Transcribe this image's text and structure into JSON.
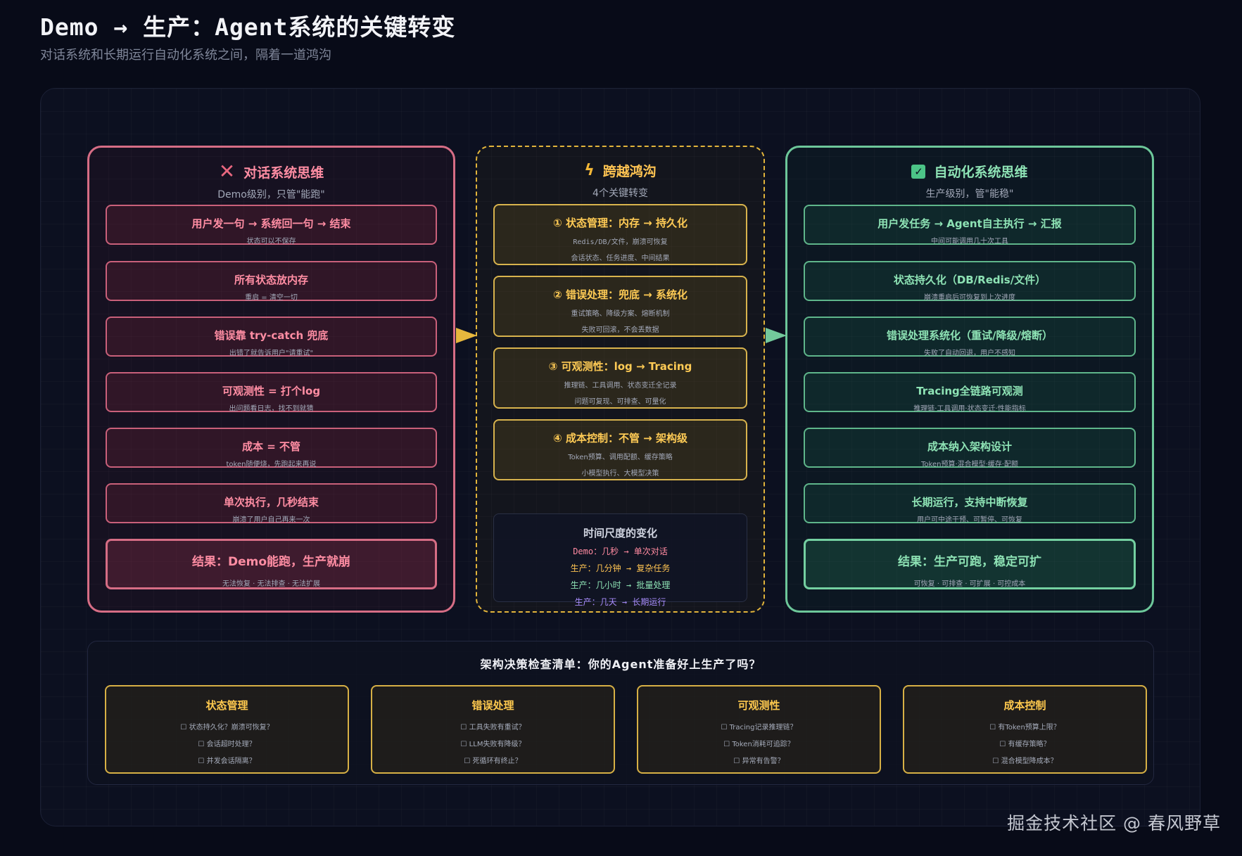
{
  "header": {
    "title": "Demo → 生产：Agent系统的关键转变",
    "subtitle": "对话系统和长期运行自动化系统之间，隔着一道鸿沟"
  },
  "left": {
    "icon": "x-icon",
    "title": "对话系统思维",
    "subtitle": "Demo级别，只管\"能跑\"",
    "cards": [
      {
        "t": "用户发一句 → 系统回一句 → 结束",
        "s": "状态可以不保存"
      },
      {
        "t": "所有状态放内存",
        "s": "重启 = 清空一切"
      },
      {
        "t": "错误靠 try-catch 兜底",
        "s": "出错了就告诉用户\"请重试\""
      },
      {
        "t": "可观测性 = 打个log",
        "s": "出问题看日志，找不到就猜"
      },
      {
        "t": "成本 = 不管",
        "s": "token随便烧，先跑起来再说"
      },
      {
        "t": "单次执行，几秒结束",
        "s": "崩溃了用户自己再来一次"
      }
    ],
    "final": {
      "t": "结果：Demo能跑，生产就崩",
      "s": "无法恢复 · 无法排查 · 无法扩展"
    }
  },
  "middle": {
    "icon": "lightning-icon",
    "title": "跨越鸿沟",
    "subtitle": "4个关键转变",
    "cards": [
      {
        "t": "① 状态管理：内存 → 持久化",
        "s": "Redis/DB/文件，崩溃可恢复",
        "s2": "会话状态、任务进度、中间结果"
      },
      {
        "t": "② 错误处理：兜底 → 系统化",
        "s": "重试策略、降级方案、熔断机制",
        "s2": "失败可回滚，不会丢数据"
      },
      {
        "t": "③ 可观测性：log → Tracing",
        "s": "推理链、工具调用、状态变迁全记录",
        "s2": "问题可复现、可排查、可量化"
      },
      {
        "t": "④ 成本控制：不管 → 架构级",
        "s": "Token预算、调用配额、缓存策略",
        "s2": "小模型执行、大模型决策"
      }
    ],
    "scale": {
      "title": "时间尺度的变化",
      "rows": [
        {
          "text": "Demo：几秒 → 单次对话",
          "color": "#ff8aa0"
        },
        {
          "text": "生产：几分钟 → 复杂任务",
          "color": "#ffc452"
        },
        {
          "text": "生产：几小时 → 批量处理",
          "color": "#8ee3b5"
        },
        {
          "text": "生产：几天 → 长期运行",
          "color": "#a78bfa"
        }
      ]
    }
  },
  "right": {
    "icon": "check-icon",
    "title": "自动化系统思维",
    "subtitle": "生产级别，管\"能稳\"",
    "cards": [
      {
        "t": "用户发任务 → Agent自主执行 → 汇报",
        "s": "中间可能调用几十次工具"
      },
      {
        "t": "状态持久化（DB/Redis/文件）",
        "s": "崩溃重启后可恢复到上次进度"
      },
      {
        "t": "错误处理系统化（重试/降级/熔断）",
        "s": "失败了自动回退，用户不感知"
      },
      {
        "t": "Tracing全链路可观测",
        "s": "推理链·工具调用·状态变迁·性能指标"
      },
      {
        "t": "成本纳入架构设计",
        "s": "Token预算·混合模型·缓存·配额"
      },
      {
        "t": "长期运行，支持中断恢复",
        "s": "用户可中途干预、可暂停、可恢复"
      }
    ],
    "final": {
      "t": "结果：生产可跑，稳定可扩",
      "s": "可恢复 · 可排查 · 可扩展 · 可控成本"
    }
  },
  "checklist": {
    "title": "架构决策检查清单：你的Agent准备好上生产了吗？",
    "groups": [
      {
        "title": "状态管理",
        "items": [
          "☐ 状态持久化？崩溃可恢复？",
          "☐ 会话超时处理？",
          "☐ 并发会话隔离？"
        ]
      },
      {
        "title": "错误处理",
        "items": [
          "☐ 工具失败有重试？",
          "☐ LLM失败有降级？",
          "☐ 死循环有终止？"
        ]
      },
      {
        "title": "可观测性",
        "items": [
          "☐ Tracing记录推理链？",
          "☐ Token消耗可追踪？",
          "☐ 异常有告警？"
        ]
      },
      {
        "title": "成本控制",
        "items": [
          "☐ 有Token预算上限？",
          "☐ 有缓存策略？",
          "☐ 混合模型降成本？"
        ]
      }
    ]
  },
  "watermark": "掘金技术社区 @ 春风野草",
  "colors": {
    "red": "#d66d85",
    "yellow": "#e2b43b",
    "green": "#6dc79a",
    "background": "#080b18"
  }
}
